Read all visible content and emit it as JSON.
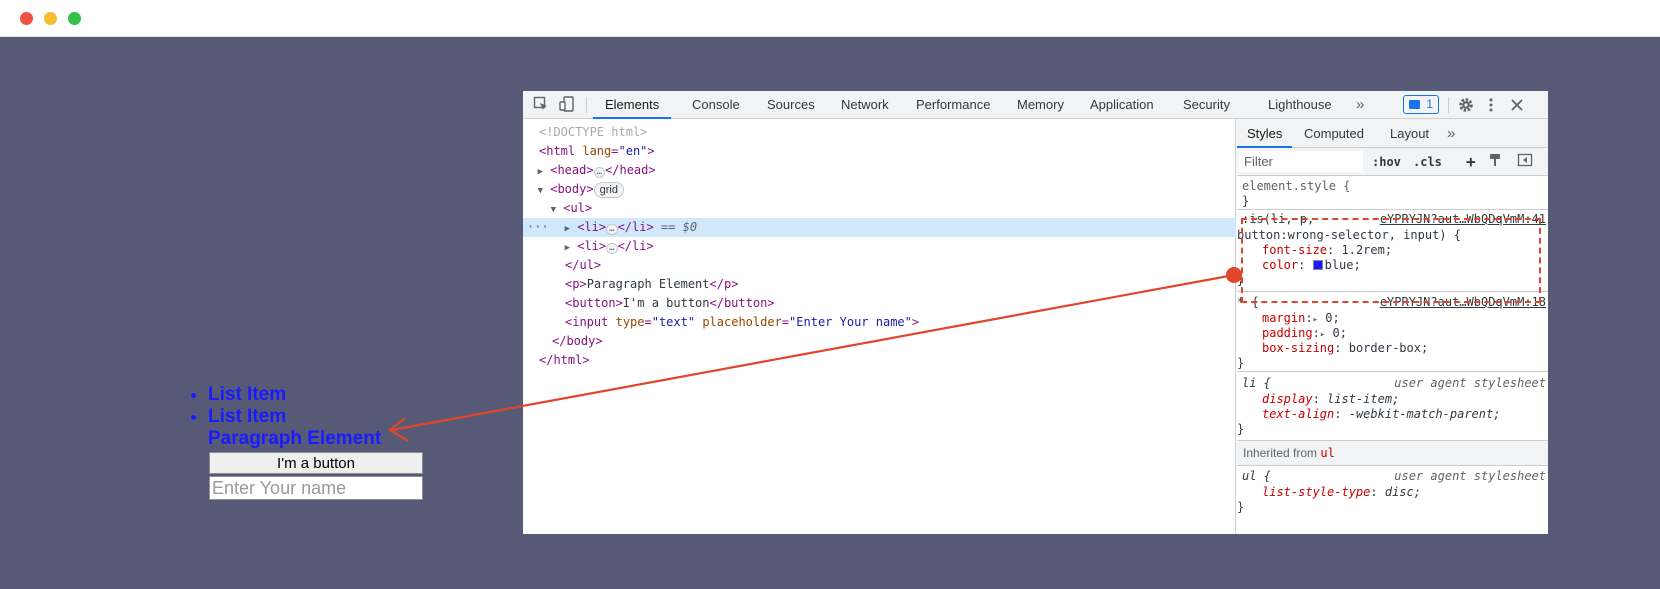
{
  "page_preview": {
    "list_items": [
      "List Item",
      "List Item"
    ],
    "paragraph": "Paragraph Element",
    "button_label": "I'm a button",
    "input_placeholder": "Enter Your name"
  },
  "devtools": {
    "tabs": [
      "Elements",
      "Console",
      "Sources",
      "Network",
      "Performance",
      "Memory",
      "Application",
      "Security",
      "Lighthouse"
    ],
    "more_tabs": "»",
    "message_count": "1",
    "active_tab": "Elements"
  },
  "elements_tree": {
    "doctype": "<!DOCTYPE html>",
    "html_open_tag": "<html",
    "lang_attr": "lang",
    "lang_eq": "=",
    "lang_value": "\"en\"",
    "close_bracket": ">",
    "head_open": "<head>",
    "head_close": "</head>",
    "body_open": "<body>",
    "grid_badge": "grid",
    "ul_open": "<ul>",
    "li_open": "<li>",
    "li_close": "</li>",
    "dollar_ref": "== $0",
    "ul_close": "</ul>",
    "p_open": "<p>",
    "p_text": "Paragraph Element",
    "p_close": "</p>",
    "button_open": "<button>",
    "button_text": "I'm a button",
    "button_close": "</button>",
    "input_open": "<input",
    "type_attr": "type",
    "type_value": "\"text\"",
    "placeholder_attr": "placeholder",
    "placeholder_value": "\"Enter Your name\"",
    "body_close": "</body>",
    "html_close": "</html>",
    "ellipsis": "…",
    "gutter_dots": "···"
  },
  "styles_panel": {
    "tabs": [
      "Styles",
      "Computed",
      "Layout"
    ],
    "more_tabs": "»",
    "filter_placeholder": "Filter",
    "hov_label": ":hov",
    "cls_label": ".cls",
    "plus_label": "+",
    "rules": {
      "element_style_selector": "element.style {",
      "element_style_close": "}",
      "is_selector_line1": ":is(li, p,",
      "is_selector_line2": "button:wrong-selector, input) {",
      "is_source": "eYPRYJN?aut…WbQDqVmM:41",
      "is_prop1_name": "font-size",
      "is_prop1_value": "1.2rem;",
      "is_prop2_name": "color",
      "is_prop2_value": "blue;",
      "is_close": "}",
      "star_selector": "* {",
      "star_source": "eYPRYJN?aut…WbQDqVmM:18",
      "star_prop1_name": "margin",
      "star_prop1_value": "0;",
      "star_prop2_name": "padding",
      "star_prop2_value": "0;",
      "star_prop3_name": "box-sizing",
      "star_prop3_value": "border-box;",
      "star_close": "}",
      "li_selector": "li {",
      "li_source": "user agent stylesheet",
      "li_prop1_name": "display",
      "li_prop1_value": "list-item;",
      "li_prop2_name": "text-align",
      "li_prop2_value": "-webkit-match-parent;",
      "li_close": "}",
      "inherited_label": "Inherited from",
      "inherited_selector": "ul",
      "ul_selector": "ul {",
      "ul_source": "user agent stylesheet",
      "ul_prop1_name": "list-style-type",
      "ul_prop1_value": "disc;",
      "ul_close": "}",
      "colon": ":",
      "expand_triangle": "▸"
    }
  },
  "colors": {
    "background": "#575a76",
    "annotation": "#e0462a",
    "accent": "#1a73e8",
    "text_blue": "#1a1aff"
  }
}
